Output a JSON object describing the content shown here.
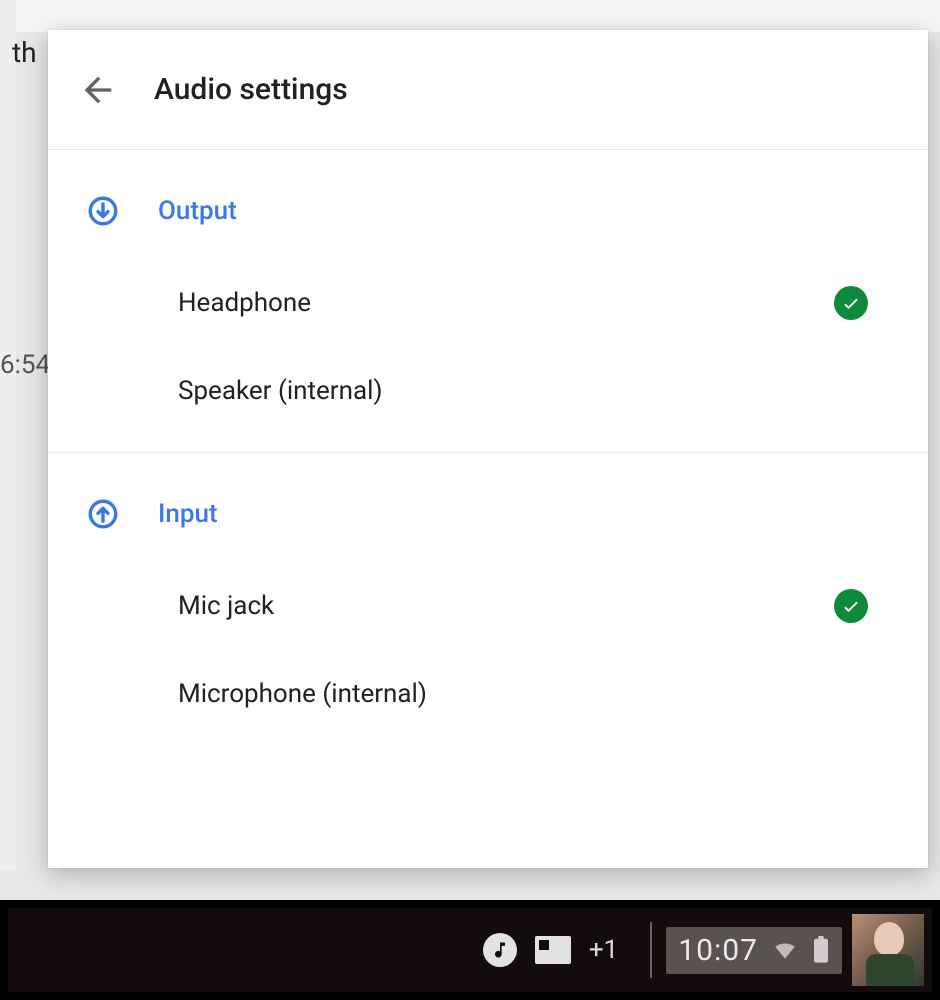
{
  "background": {
    "text_left": "th",
    "time_fragment": "6:54"
  },
  "panel": {
    "title": "Audio settings"
  },
  "output": {
    "label": "Output",
    "options": [
      {
        "label": "Headphone",
        "selected": true
      },
      {
        "label": "Speaker (internal)",
        "selected": false
      }
    ]
  },
  "input": {
    "label": "Input",
    "options": [
      {
        "label": "Mic jack",
        "selected": true
      },
      {
        "label": "Microphone (internal)",
        "selected": false
      }
    ]
  },
  "shelf": {
    "overflow_count": "+1",
    "clock": "10:07"
  },
  "colors": {
    "accent": "#3b78e7",
    "check": "#0f8a3c"
  }
}
